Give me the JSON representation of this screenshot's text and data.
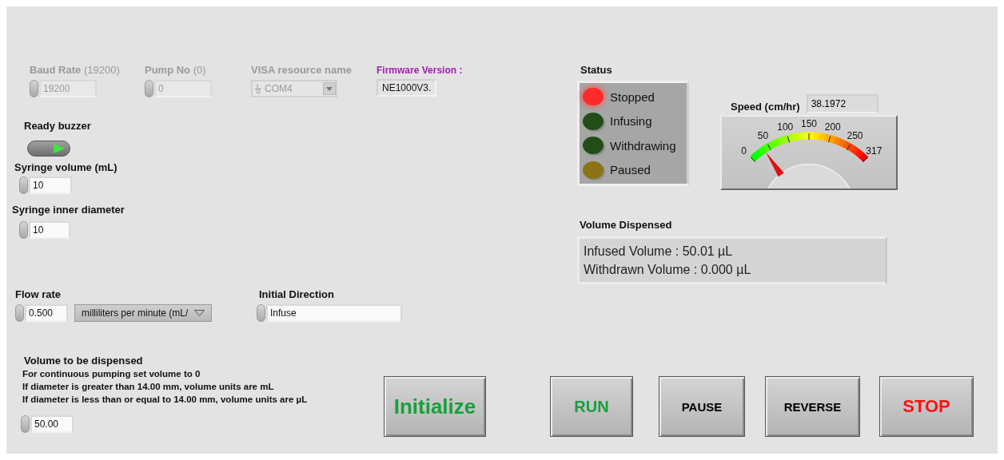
{
  "settings": [
    {
      "label": "Baud Rate",
      "label_note": "(19200)",
      "value": "19200",
      "kind": "numeric",
      "disabled": true
    },
    {
      "label": "Pump No",
      "label_note": "(0)",
      "value": "0",
      "kind": "numeric",
      "disabled": true
    },
    {
      "label": "VISA resource name",
      "value": "COM4",
      "kind": "visa",
      "disabled": true
    }
  ],
  "firmware": {
    "label": "Firmware Version :",
    "value": "NE1000V3."
  },
  "ready_buzzer": {
    "label": "Ready buzzer",
    "on": true
  },
  "syringe_volume": {
    "label": "Syringe volume (mL)",
    "value": "10"
  },
  "syringe_diameter": {
    "label": "Syringe inner diameter",
    "value": "10"
  },
  "flow_rate": {
    "label": "Flow rate",
    "value": "0.500",
    "units": "milliliters per minute (mL/"
  },
  "initial_direction": {
    "label": "Initial Direction",
    "value": "Infuse"
  },
  "volume_to_dispense": {
    "label": "Volume to be dispensed",
    "notes": [
      "For continuous pumping set volume to 0",
      "If diameter is greater than 14.00 mm, volume units are mL",
      "If diameter is less than or equal to 14.00 mm, volume units are µL"
    ],
    "value": "50.00"
  },
  "status": {
    "label": "Status",
    "indicators": [
      {
        "label": "Stopped",
        "on": true,
        "color": "#ff2a2a"
      },
      {
        "label": "Infusing",
        "on": false,
        "color": "#234d17"
      },
      {
        "label": "Withdrawing",
        "on": false,
        "color": "#234d17"
      },
      {
        "label": "Paused",
        "on": false,
        "color": "#8a7416"
      }
    ]
  },
  "speed": {
    "label": "Speed (cm/hr)",
    "value": "38.1972",
    "scale": [
      "0",
      "50",
      "100",
      "150",
      "200",
      "250",
      "317"
    ]
  },
  "volume_dispensed": {
    "label": "Volume Dispensed",
    "lines": [
      "Infused Volume : 50.01 µL",
      "Withdrawn Volume : 0.000 µL"
    ]
  },
  "buttons": [
    {
      "label": "Initialize",
      "color": "#17a03c"
    },
    {
      "label": "RUN",
      "color": "#17a03c"
    },
    {
      "label": "PAUSE",
      "color": "#000000"
    },
    {
      "label": "REVERSE",
      "color": "#000000"
    },
    {
      "label": "STOP",
      "color": "#ff1010"
    }
  ]
}
